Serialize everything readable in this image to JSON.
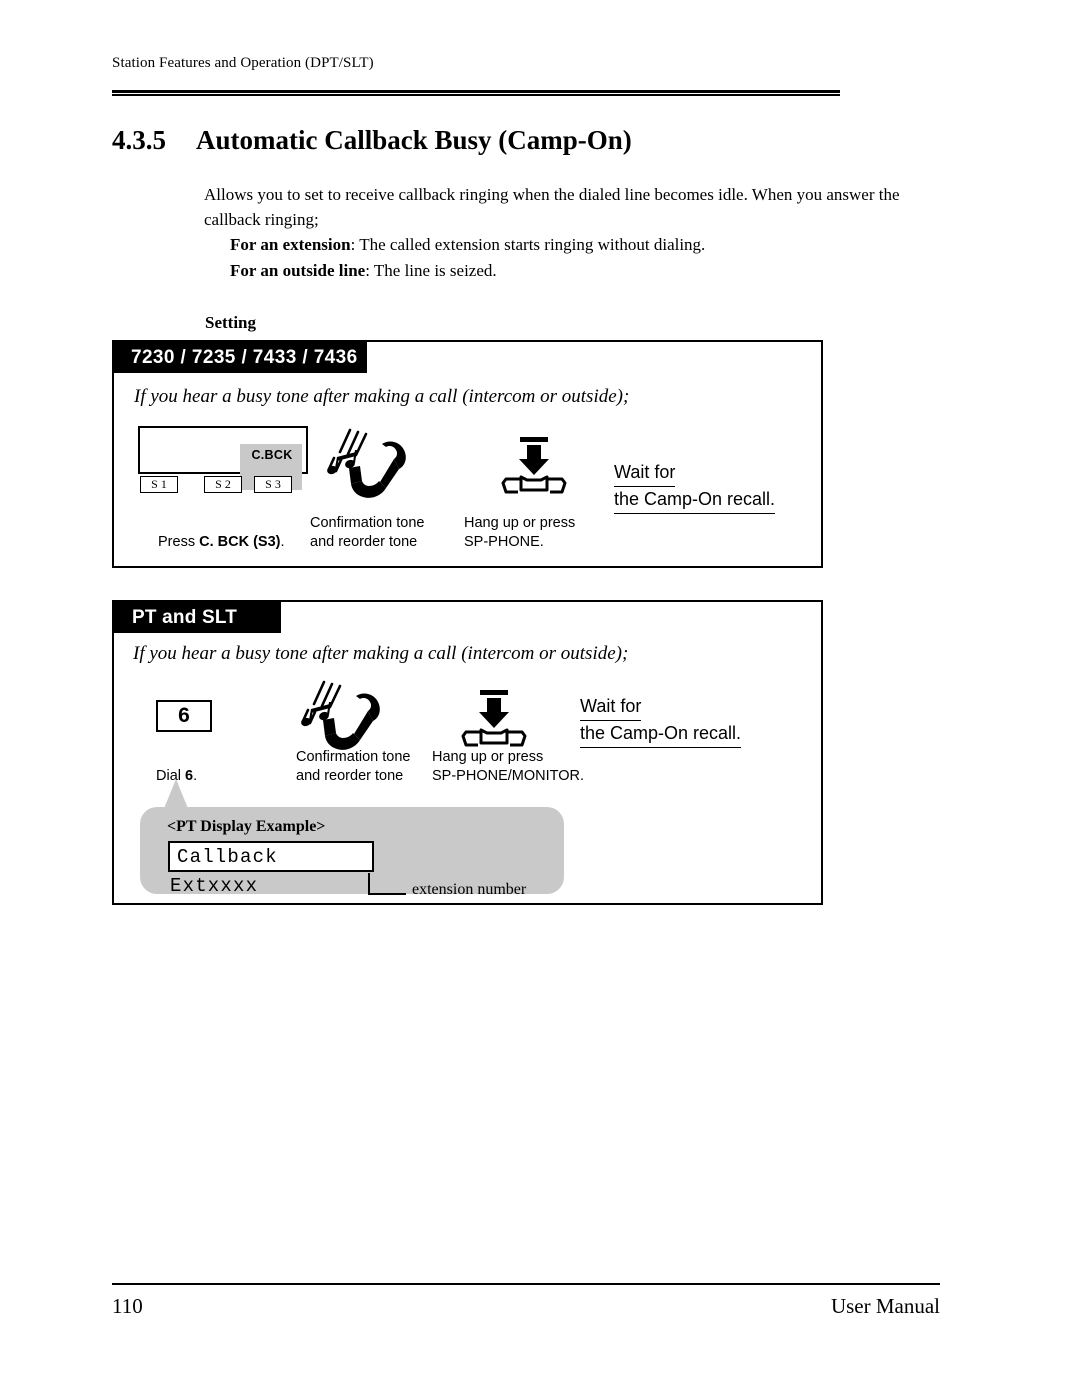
{
  "header": {
    "running_head": "Station Features and Operation (DPT/SLT)"
  },
  "title": {
    "number": "4.3.5",
    "text": "Automatic Callback Busy (Camp-On)"
  },
  "intro": {
    "paragraph": "Allows you to set to receive callback ringing when the dialed line becomes idle. When you answer the callback ringing;",
    "extension_label": "For an extension",
    "extension_text": ": The called extension starts ringing without dialing.",
    "outside_label": "For an outside line",
    "outside_text": ": The line is seized."
  },
  "setting": {
    "label": "Setting"
  },
  "box1": {
    "tab": "7230 / 7235 / 7433 / 7436",
    "condition": "If you hear a busy tone after making a call (intercom or outside);",
    "display": {
      "softkey_label": "C.BCK",
      "softkeys": [
        "S 1",
        "S 2",
        "S 3"
      ]
    },
    "steps": [
      {
        "caption_pre": "Press ",
        "caption_bold": "C. BCK (S3)",
        "caption_post": "."
      },
      {
        "caption": "Confirmation tone\nand reorder tone"
      },
      {
        "caption": "Hang up or press\nSP-PHONE."
      }
    ],
    "wait_line1": "Wait for",
    "wait_line2": "the Camp-On recall."
  },
  "box2": {
    "tab": "PT and SLT",
    "condition": "If you hear a busy tone after making a call  (intercom or outside);",
    "key": "6",
    "steps": [
      {
        "caption_pre": "Dial ",
        "caption_bold": "6",
        "caption_post": "."
      },
      {
        "caption": "Confirmation tone\nand reorder tone"
      },
      {
        "caption": "Hang up or press\nSP-PHONE/MONITOR."
      }
    ],
    "wait_line1": "Wait for",
    "wait_line2": "the Camp-On recall.",
    "callout": {
      "title": "<PT Display Example>",
      "lcd_text": "Callback Extxxxx",
      "leader_label": "extension number"
    }
  },
  "footer": {
    "page_number": "110",
    "manual_title": "User Manual"
  },
  "colors": {
    "gray": "#c9c9c9",
    "black": "#000000",
    "white": "#ffffff"
  }
}
